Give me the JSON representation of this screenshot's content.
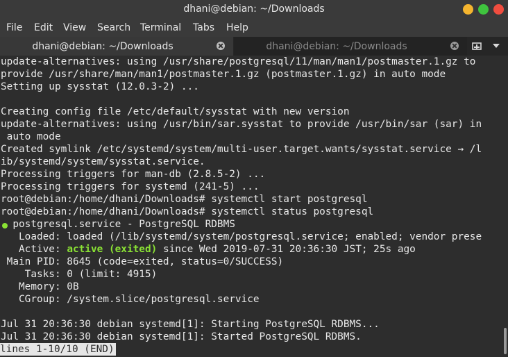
{
  "window": {
    "title": "dhani@debian: ~/Downloads"
  },
  "menu": {
    "items": [
      "File",
      "Edit",
      "View",
      "Search",
      "Terminal",
      "Tabs",
      "Help"
    ]
  },
  "tabs": [
    {
      "label": "dhani@debian: ~/Downloads",
      "active": true
    },
    {
      "label": "dhani@debian: ~/Downloads",
      "active": false
    }
  ],
  "terminal": {
    "lines": [
      "update-alternatives: using /usr/share/postgresql/11/man/man1/postmaster.1.gz to",
      "provide /usr/share/man/man1/postmaster.1.gz (postmaster.1.gz) in auto mode",
      "Setting up sysstat (12.0.3-2) ...",
      "",
      "Creating config file /etc/default/sysstat with new version",
      "update-alternatives: using /usr/bin/sar.sysstat to provide /usr/bin/sar (sar) in",
      " auto mode",
      "Created symlink /etc/systemd/system/multi-user.target.wants/sysstat.service → /l",
      "ib/systemd/system/sysstat.service.",
      "Processing triggers for man-db (2.8.5-2) ...",
      "Processing triggers for systemd (241-5) ...",
      "root@debian:/home/dhani/Downloads# systemctl start postgresql",
      "root@debian:/home/dhani/Downloads# systemctl status postgresql"
    ],
    "service_line": "  postgresql.service - PostgreSQL RDBMS",
    "loaded_line": "   Loaded: loaded (/lib/systemd/system/postgresql.service; enabled; vendor prese",
    "active_prefix": "   Active: ",
    "active_status": "active (exited)",
    "active_suffix": " since Wed 2019-07-31 20:36:30 JST; 25s ago",
    "detail_lines": [
      " Main PID: 8645 (code=exited, status=0/SUCCESS)",
      "    Tasks: 0 (limit: 4915)",
      "   Memory: 0B",
      "   CGroup: /system.slice/postgresql.service",
      "",
      "Jul 31 20:36:30 debian systemd[1]: Starting PostgreSQL RDBMS...",
      "Jul 31 20:36:30 debian systemd[1]: Started PostgreSQL RDBMS."
    ],
    "pager_status": "lines 1-10/10 (END)"
  },
  "colors": {
    "status_green": "#8ae234",
    "terminal_bg": "#2d2d2d",
    "text": "#e8e8e8"
  },
  "icons": {
    "tab_close": "close-icon",
    "new_tab": "new-tab-icon",
    "tab_menu": "chevron-down-icon"
  }
}
